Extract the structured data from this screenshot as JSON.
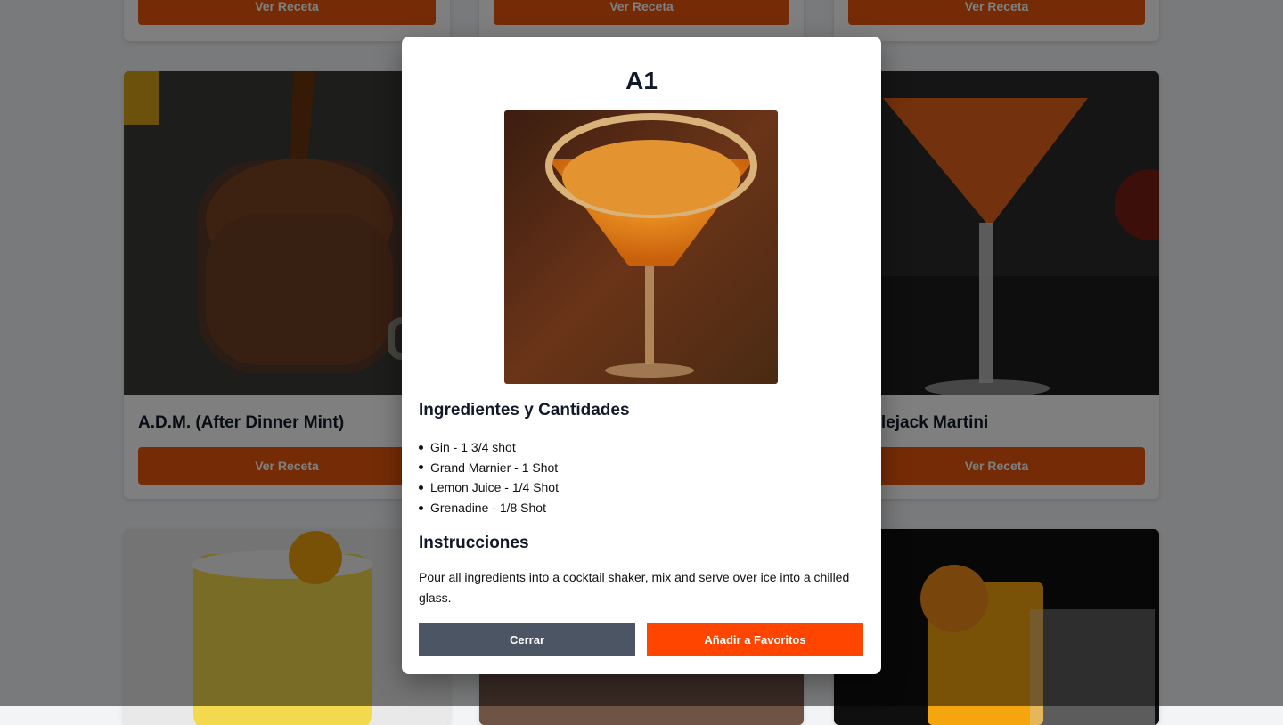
{
  "cards": {
    "view_label": "Ver Receta",
    "row2_left_title": "A.D.M. (After Dinner Mint)",
    "row2_right_title": "Applejack Martini"
  },
  "modal": {
    "title": "A1",
    "ingredients_heading": "Ingredientes y Cantidades",
    "ingredients": [
      "Gin - 1 3/4 shot",
      "Grand Marnier - 1 Shot",
      "Lemon Juice - 1/4 Shot",
      "Grenadine - 1/8 Shot"
    ],
    "instructions_heading": "Instrucciones",
    "instructions": "Pour all ingredients into a cocktail shaker, mix and serve over ice into a chilled glass.",
    "close_label": "Cerrar",
    "favorite_label": "Añadir a Favoritos"
  },
  "colors": {
    "accent": "#ea580c",
    "favorite": "#ff4500",
    "close": "#4b5563"
  }
}
